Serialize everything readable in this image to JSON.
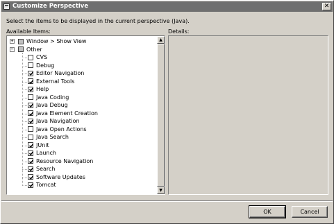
{
  "window": {
    "title": "Customize Perspective",
    "close_glyph": "✕"
  },
  "instructions": "Select the items to be displayed in the current perspective (Java).",
  "available_label": "Available Items:",
  "details_label": "Details:",
  "tree": {
    "items": [
      {
        "label": "Window > Show View",
        "level": 0,
        "expander": "+",
        "state": "partial"
      },
      {
        "label": "Other",
        "level": 0,
        "expander": "−",
        "state": "partial"
      },
      {
        "label": "CVS",
        "level": 1,
        "state": "unchecked"
      },
      {
        "label": "Debug",
        "level": 1,
        "state": "unchecked"
      },
      {
        "label": "Editor Navigation",
        "level": 1,
        "state": "checked"
      },
      {
        "label": "External Tools",
        "level": 1,
        "state": "checked"
      },
      {
        "label": "Help",
        "level": 1,
        "state": "checked"
      },
      {
        "label": "Java Coding",
        "level": 1,
        "state": "unchecked"
      },
      {
        "label": "Java Debug",
        "level": 1,
        "state": "checked"
      },
      {
        "label": "Java Element Creation",
        "level": 1,
        "state": "checked"
      },
      {
        "label": "Java Navigation",
        "level": 1,
        "state": "checked"
      },
      {
        "label": "Java Open Actions",
        "level": 1,
        "state": "unchecked"
      },
      {
        "label": "Java Search",
        "level": 1,
        "state": "unchecked"
      },
      {
        "label": "JUnit",
        "level": 1,
        "state": "checked"
      },
      {
        "label": "Launch",
        "level": 1,
        "state": "checked"
      },
      {
        "label": "Resource Navigation",
        "level": 1,
        "state": "checked"
      },
      {
        "label": "Search",
        "level": 1,
        "state": "checked"
      },
      {
        "label": "Software Updates",
        "level": 1,
        "state": "checked"
      },
      {
        "label": "Tomcat",
        "level": 1,
        "state": "checked"
      }
    ]
  },
  "scrollbar": {
    "up_glyph": "▲",
    "down_glyph": "▼"
  },
  "buttons": {
    "ok": "OK",
    "cancel": "Cancel"
  },
  "colors": {
    "titlebar": "#6f6f6f",
    "dialog": "#d4d0c8"
  }
}
